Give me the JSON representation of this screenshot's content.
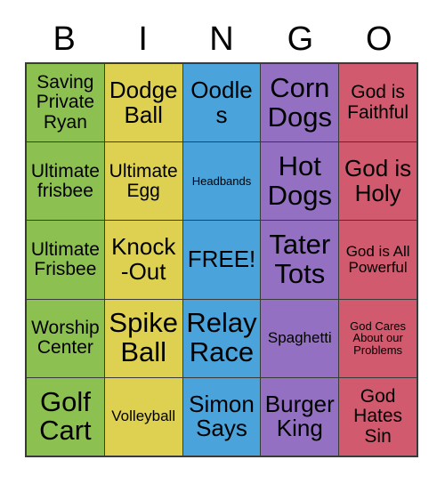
{
  "card": {
    "header_letters": [
      "B",
      "I",
      "N",
      "G",
      "O"
    ],
    "column_colors": {
      "B": "#8CC152",
      "I": "#DED152",
      "N": "#4AA3DB",
      "G": "#9370C2",
      "O": "#D25A6E"
    },
    "border_color": "#3a3a3a",
    "text_color": "#000000",
    "background": "#ffffff",
    "free_space": "FREE!",
    "rows": [
      [
        {
          "text": "Saving Private Ryan",
          "column": "B",
          "size": "md"
        },
        {
          "text": "Dodge Ball",
          "column": "I",
          "size": "lg"
        },
        {
          "text": "Oodles",
          "column": "N",
          "size": "lg"
        },
        {
          "text": "Corn Dogs",
          "column": "G",
          "size": "xl"
        },
        {
          "text": "God is Faithful",
          "column": "O",
          "size": "md"
        }
      ],
      [
        {
          "text": "Ultimate frisbee",
          "column": "B",
          "size": "md"
        },
        {
          "text": "Ultimate Egg",
          "column": "I",
          "size": "md"
        },
        {
          "text": "Headbands",
          "column": "N",
          "size": "xs"
        },
        {
          "text": "Hot Dogs",
          "column": "G",
          "size": "xl"
        },
        {
          "text": "God is Holy",
          "column": "O",
          "size": "lg"
        }
      ],
      [
        {
          "text": "Ultimate Frisbee",
          "column": "B",
          "size": "md"
        },
        {
          "text": "Knock-Out",
          "column": "I",
          "size": "lg"
        },
        {
          "text": "FREE!",
          "column": "N",
          "size": "lg"
        },
        {
          "text": "Tater Tots",
          "column": "G",
          "size": "xl"
        },
        {
          "text": "God is All Powerful",
          "column": "O",
          "size": "sm"
        }
      ],
      [
        {
          "text": "Worship Center",
          "column": "B",
          "size": "md"
        },
        {
          "text": "Spike Ball",
          "column": "I",
          "size": "xl"
        },
        {
          "text": "Relay Race",
          "column": "N",
          "size": "xl"
        },
        {
          "text": "Spaghetti",
          "column": "G",
          "size": "sm"
        },
        {
          "text": "God Cares About our Problems",
          "column": "O",
          "size": "xs"
        }
      ],
      [
        {
          "text": "Golf Cart",
          "column": "B",
          "size": "xl"
        },
        {
          "text": "Volleyball",
          "column": "I",
          "size": "sm"
        },
        {
          "text": "Simon Says",
          "column": "N",
          "size": "lg"
        },
        {
          "text": "Burger King",
          "column": "G",
          "size": "lg"
        },
        {
          "text": "God Hates Sin",
          "column": "O",
          "size": "md"
        }
      ]
    ]
  }
}
